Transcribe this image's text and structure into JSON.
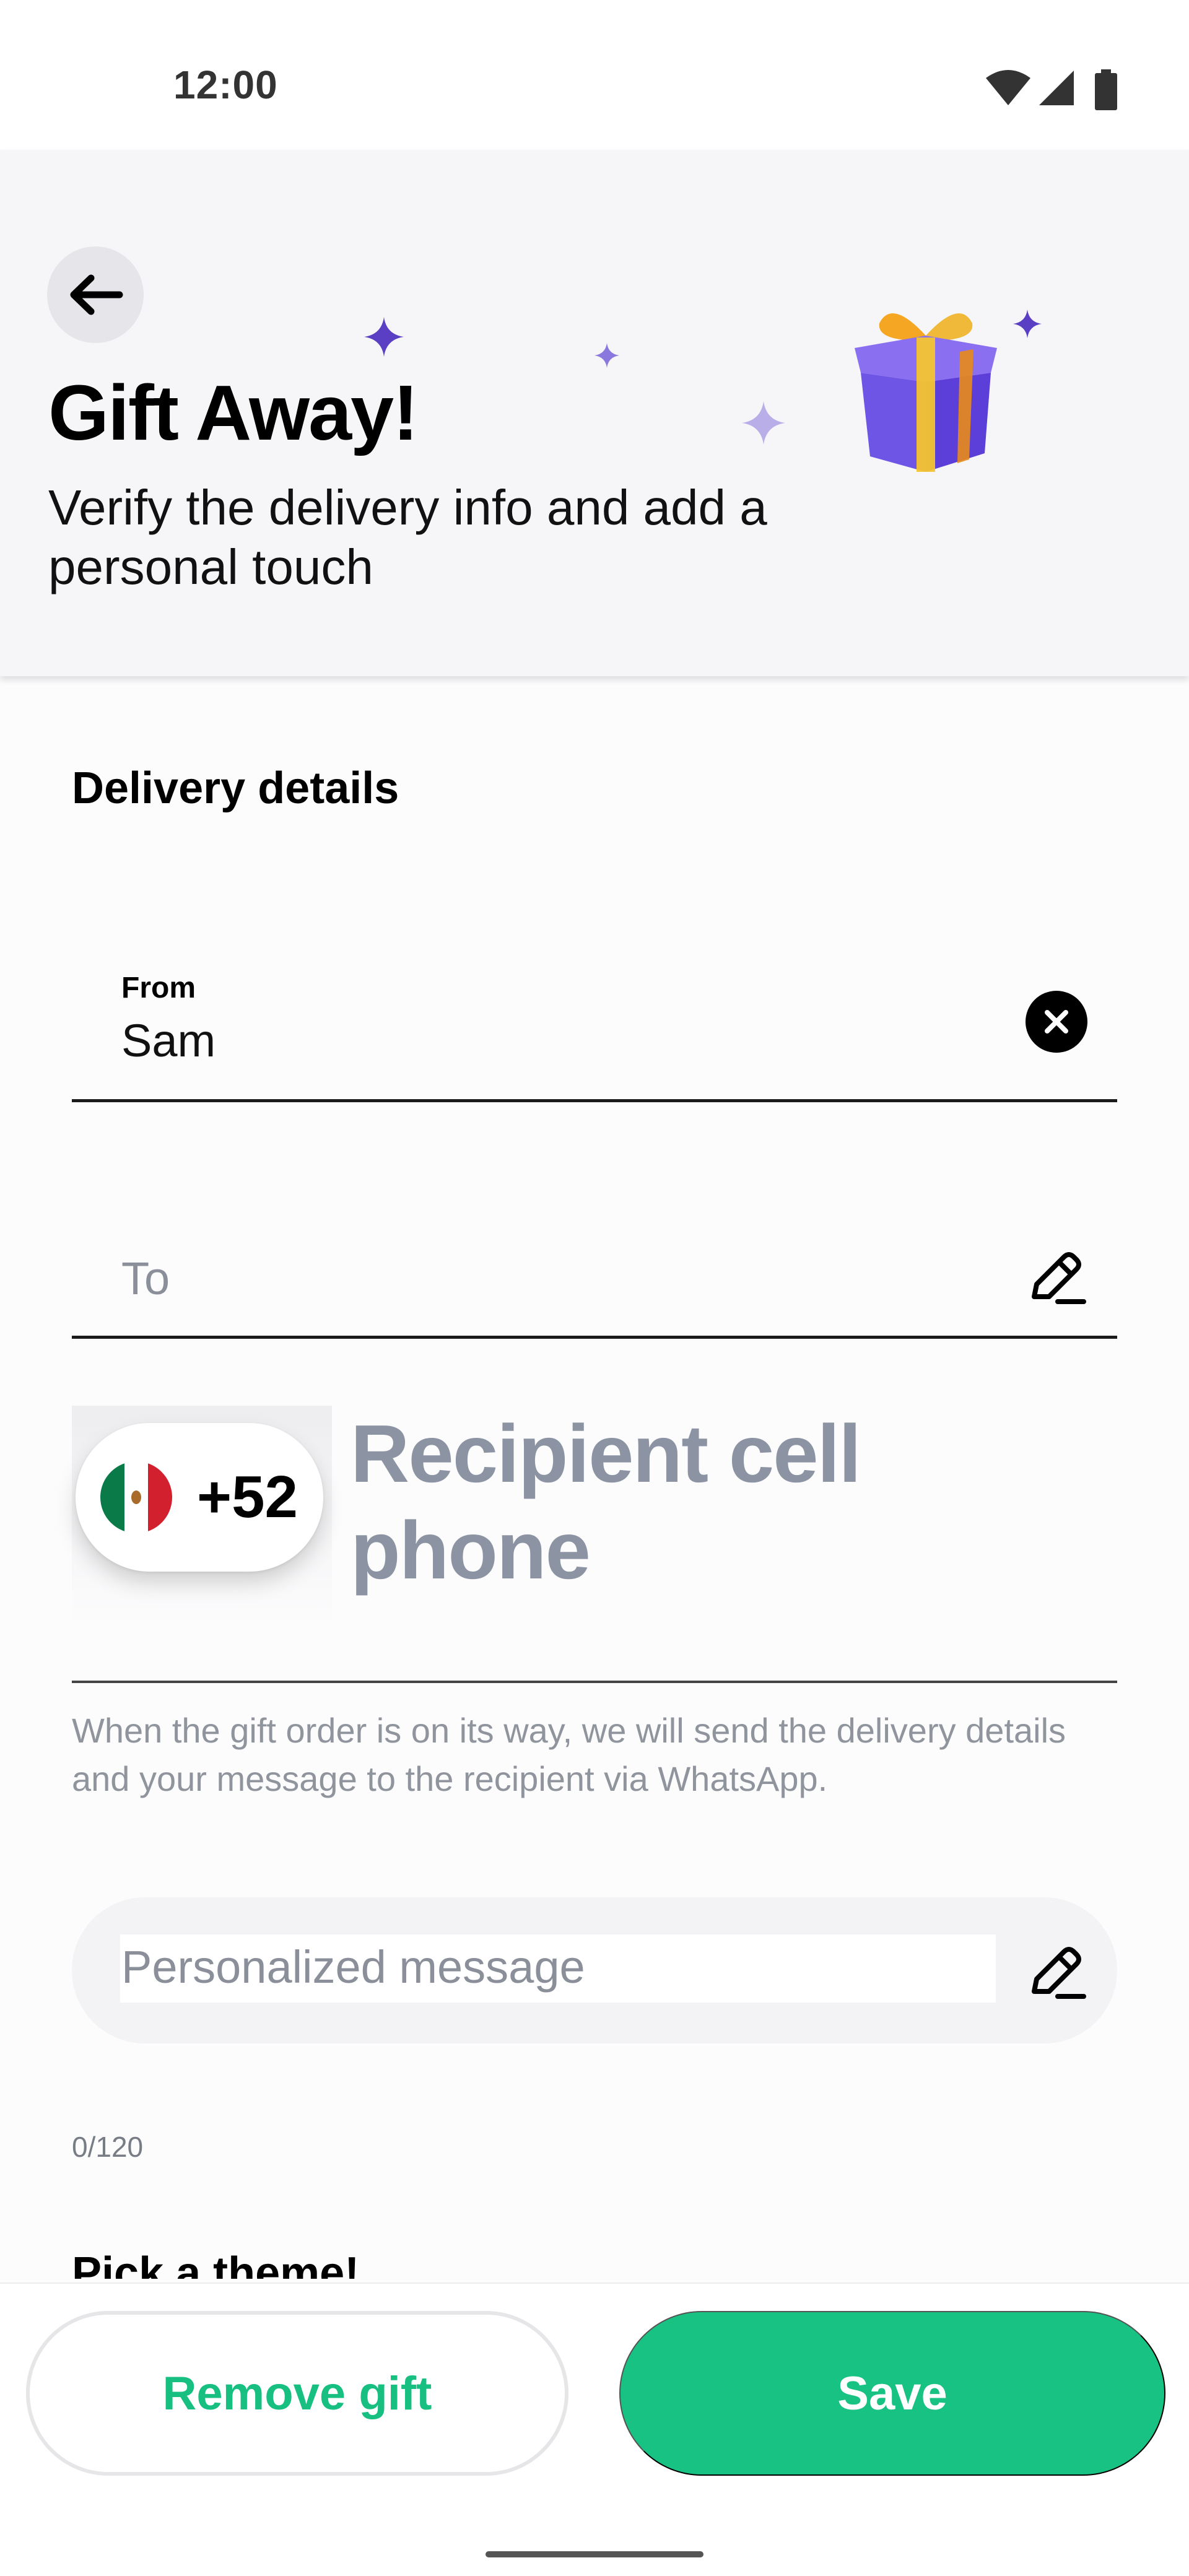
{
  "status_bar": {
    "time": "12:00",
    "icons": [
      "wifi-icon",
      "signal-icon",
      "battery-icon"
    ]
  },
  "header": {
    "back_icon": "arrow-left-icon",
    "title": "Gift Away!",
    "subtitle": "Verify the delivery info and add a personal touch",
    "illustration": "gift-box-icon"
  },
  "delivery": {
    "section_title": "Delivery details",
    "from": {
      "label": "From",
      "value": "Sam",
      "action_icon": "clear-icon"
    },
    "to": {
      "placeholder": "To",
      "action_icon": "edit-pencil-icon"
    },
    "phone": {
      "country_flag": "mexico-flag-icon",
      "country_code": "+52",
      "placeholder": "Recipient cell phone"
    },
    "helper_text": "When the gift order is on its way, we will send the delivery details and your message to the recipient via WhatsApp."
  },
  "message": {
    "placeholder": "Personalized message",
    "action_icon": "edit-pencil-icon",
    "counter": "0/120"
  },
  "theme": {
    "title": "Pick a theme!"
  },
  "footer": {
    "remove_label": "Remove gift",
    "save_label": "Save"
  },
  "colors": {
    "accent": "#18c282",
    "header_bg": "#f6f6f9",
    "placeholder": "#8c93a3"
  }
}
